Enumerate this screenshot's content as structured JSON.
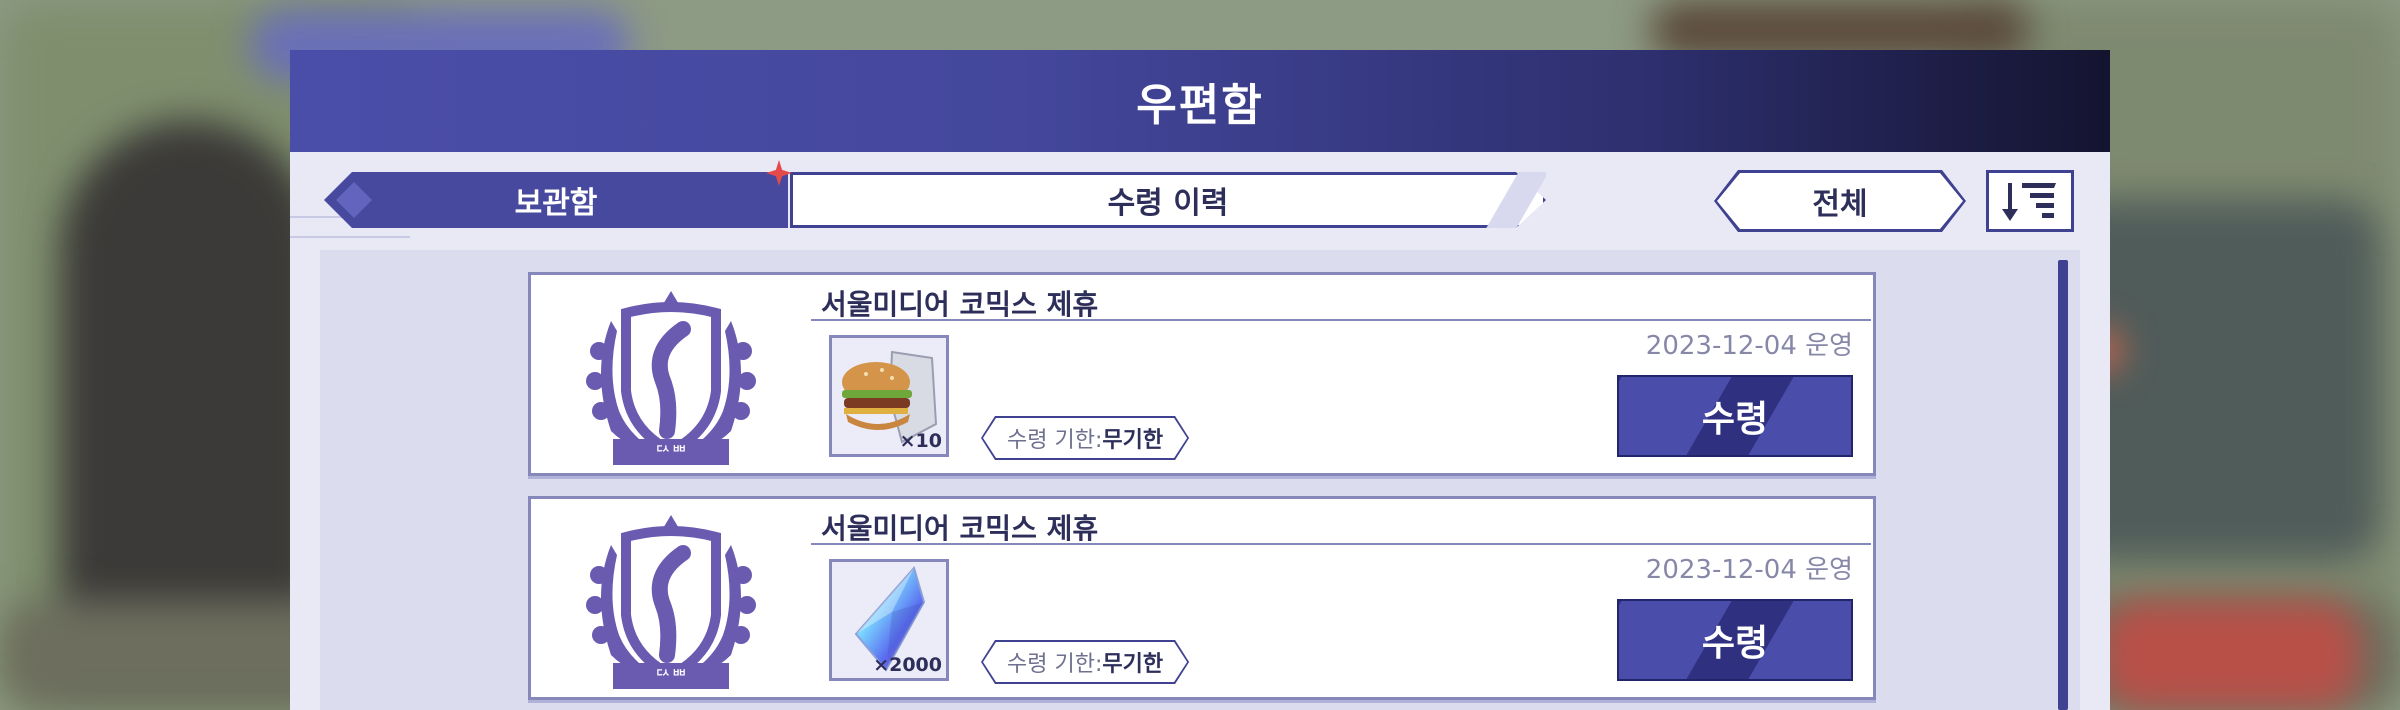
{
  "mailbox": {
    "title": "우편함",
    "tabs": [
      {
        "label": "보관함",
        "active": true
      },
      {
        "label": "수령 이력",
        "active": false
      }
    ],
    "filter_label": "전체",
    "sort_icon": "sort-descending-icon",
    "mails": [
      {
        "title": "서울미디어 코믹스 제휴",
        "date": "2023-12-04 운영",
        "item_icon": "hamburger-icon",
        "item_count": "×10",
        "expiry_label": "수령 기한:",
        "expiry_value": "무기한",
        "claim_label": "수령"
      },
      {
        "title": "서울미디어 코믹스 제휴",
        "date": "2023-12-04 운영",
        "item_icon": "crystal-icon",
        "item_count": "×2000",
        "expiry_label": "수령 기한:",
        "expiry_value": "무기한",
        "claim_label": "수령"
      }
    ],
    "emblem_text": "ᄃᄉᄈ"
  },
  "colors": {
    "accent": "#46499e",
    "header_start": "#4b4ea8",
    "header_end": "#141430",
    "notification": "#e54a4a"
  }
}
